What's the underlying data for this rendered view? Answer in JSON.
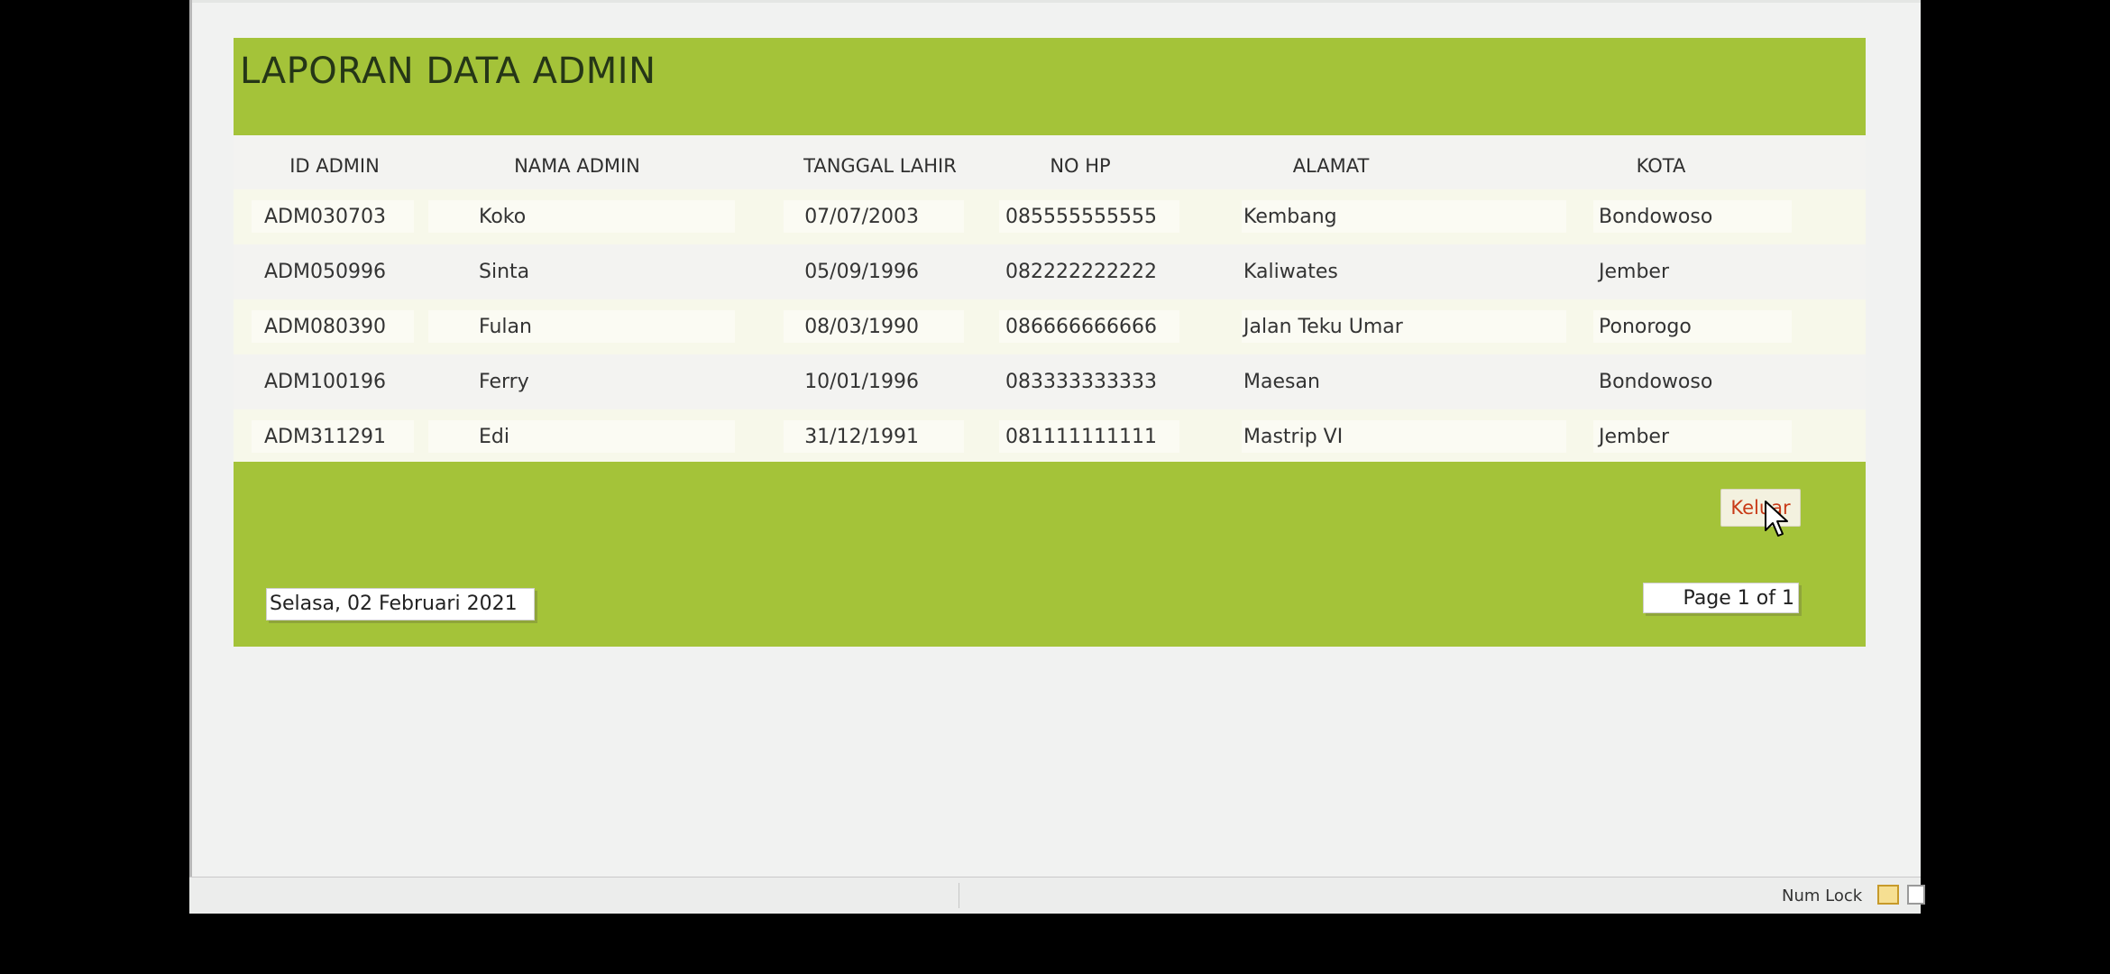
{
  "report": {
    "title": "LAPORAN DATA ADMIN",
    "columns": [
      "ID ADMIN",
      "NAMA ADMIN",
      "TANGGAL LAHIR",
      "NO HP",
      "ALAMAT",
      "KOTA"
    ],
    "rows": [
      {
        "id": "ADM030703",
        "nama": "Koko",
        "tanggal": "07/07/2003",
        "hp": "085555555555",
        "alamat": "Kembang",
        "kota": "Bondowoso"
      },
      {
        "id": "ADM050996",
        "nama": "Sinta",
        "tanggal": "05/09/1996",
        "hp": "082222222222",
        "alamat": "Kaliwates",
        "kota": "Jember"
      },
      {
        "id": "ADM080390",
        "nama": "Fulan",
        "tanggal": "08/03/1990",
        "hp": "086666666666",
        "alamat": "Jalan Teku Umar",
        "kota": "Ponorogo"
      },
      {
        "id": "ADM100196",
        "nama": "Ferry",
        "tanggal": "10/01/1996",
        "hp": "083333333333",
        "alamat": "Maesan",
        "kota": "Bondowoso"
      },
      {
        "id": "ADM311291",
        "nama": "Edi",
        "tanggal": "31/12/1991",
        "hp": "081111111111",
        "alamat": "Mastrip VI",
        "kota": "Jember"
      }
    ],
    "footer": {
      "exit_label": "Keluar",
      "date": "Selasa, 02 Februari 2021",
      "page": "Page 1 of 1"
    }
  },
  "statusbar": {
    "numlock": "Num Lock"
  },
  "colors": {
    "header_green": "#a4c339",
    "exit_text": "#c83a17",
    "row_tint": "#f7f8ea"
  },
  "icons": [
    "cursor-arrow-icon",
    "report-view-icon",
    "layout-view-icon"
  ]
}
